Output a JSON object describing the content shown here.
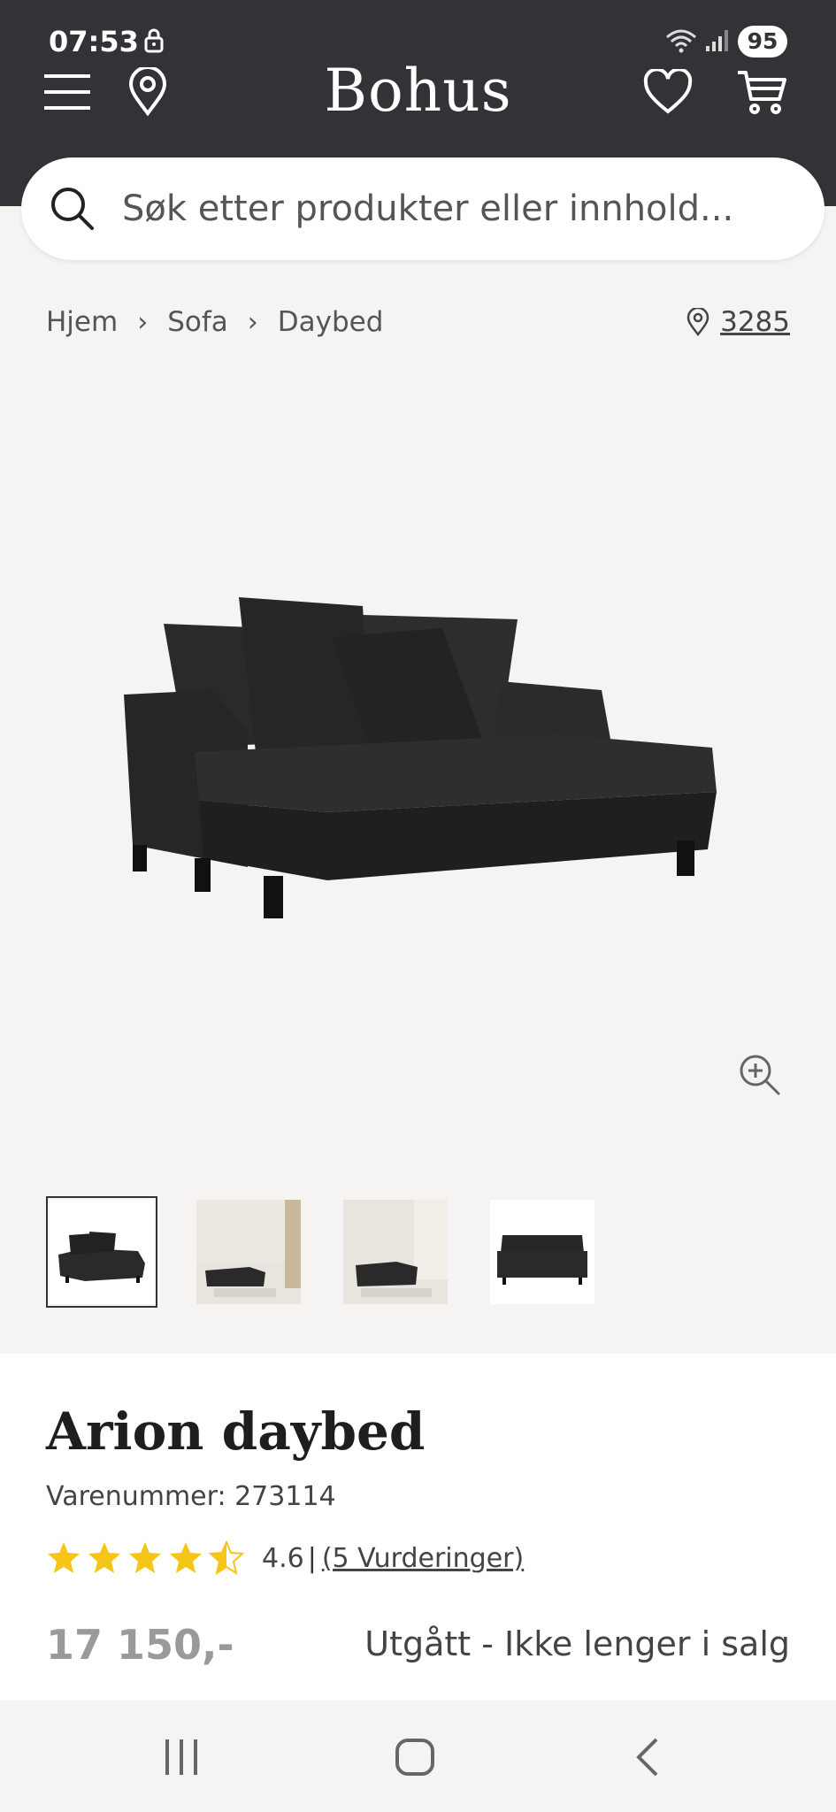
{
  "status_bar": {
    "time": "07:53",
    "battery": "95"
  },
  "header": {
    "logo": "Bohus"
  },
  "search": {
    "placeholder": "Søk etter produkter eller innhold..."
  },
  "breadcrumb": {
    "items": [
      "Hjem",
      "Sofa",
      "Daybed"
    ],
    "store_number": "3285"
  },
  "gallery": {
    "thumbnail_count": 4,
    "active_index": 0
  },
  "product": {
    "name": "Arion daybed",
    "sku": "Varenummer: 273114",
    "rating": 4.6,
    "rating_text": "4.6",
    "rating_separator": "|",
    "reviews": "(5 Vurderinger)",
    "price": "17 150,-",
    "availability": "Utgått - Ikke lenger i salg"
  },
  "colors": {
    "header_bg": "#333236",
    "star": "#f5c518",
    "background": "#f5f4f3"
  },
  "icons": [
    "menu-icon",
    "location-pin-icon",
    "heart-icon",
    "cart-icon",
    "search-icon",
    "zoom-in-icon"
  ]
}
